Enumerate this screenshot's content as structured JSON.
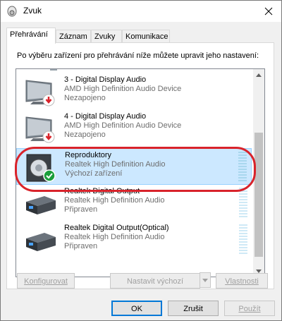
{
  "window": {
    "title": "Zvuk"
  },
  "tabs": [
    {
      "label": "Přehrávání",
      "active": true
    },
    {
      "label": "Záznam"
    },
    {
      "label": "Zvuky"
    },
    {
      "label": "Komunikace"
    }
  ],
  "instruction": "Po výběru zařízení pro přehrávání níže můžete upravit jeho nastavení:",
  "devices": [
    {
      "name": "3 - Digital Display Audio",
      "driver": "AMD High Definition Audio Device",
      "status": "Nezapojeno",
      "icon": "monitor-disconnected-icon"
    },
    {
      "name": "4 - Digital Display Audio",
      "driver": "AMD High Definition Audio Device",
      "status": "Nezapojeno",
      "icon": "monitor-disconnected-icon"
    },
    {
      "name": "Reproduktory",
      "driver": "Realtek High Definition Audio",
      "status": "Výchozí zařízení",
      "icon": "speaker-default-icon",
      "selected": true
    },
    {
      "name": "Realtek Digital Output",
      "driver": "Realtek High Definition Audio",
      "status": "Připraven",
      "icon": "digital-output-icon"
    },
    {
      "name": "Realtek Digital Output(Optical)",
      "driver": "Realtek High Definition Audio",
      "status": "Připraven",
      "icon": "optical-output-icon"
    }
  ],
  "buttons": {
    "configure": "Konfigurovat",
    "set_default": "Nastavit výchozí",
    "properties": "Vlastnosti",
    "ok": "OK",
    "cancel": "Zrušit",
    "apply": "Použít"
  },
  "colors": {
    "selection": "#cce8ff",
    "highlight_ring": "#d9232b",
    "default_check": "#1a9e3a",
    "disconnected_arrow": "#d9232b"
  }
}
